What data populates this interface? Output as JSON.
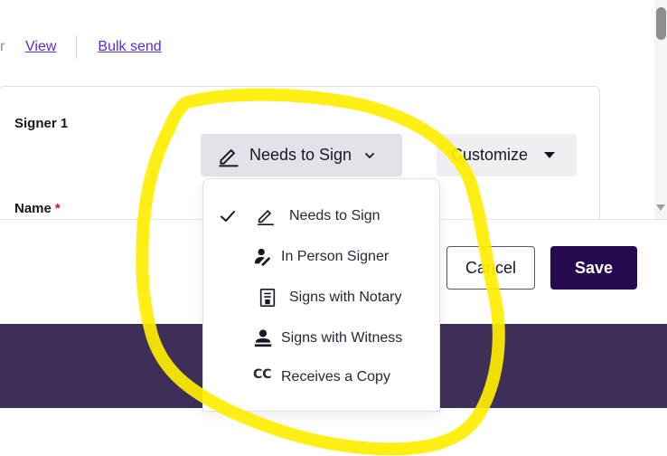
{
  "top_links": {
    "fragment": "r",
    "view": "View",
    "bulk_send": "Bulk send"
  },
  "recipient": {
    "signer_title": "Signer 1",
    "name_label": "Name",
    "required_mark": "*",
    "role_button_label": "Needs to Sign",
    "customize_label": "Customize"
  },
  "dropdown": {
    "items": [
      {
        "label": "Needs to Sign",
        "icon": "pen-icon",
        "selected": true
      },
      {
        "label": "In Person Signer",
        "icon": "in-person-signer-icon",
        "selected": false
      },
      {
        "label": "Signs with Notary",
        "icon": "notary-document-icon",
        "selected": false
      },
      {
        "label": "Signs with Witness",
        "icon": "witness-person-icon",
        "selected": false
      },
      {
        "label": "Receives a Copy",
        "icon": "cc-icon",
        "selected": false
      }
    ]
  },
  "footer": {
    "cancel": "Cancel",
    "save": "Save"
  },
  "colors": {
    "accent": "#26094f",
    "link": "#5b2bd1",
    "highlight": "#ffee00",
    "overlay": "#3f2f58"
  }
}
